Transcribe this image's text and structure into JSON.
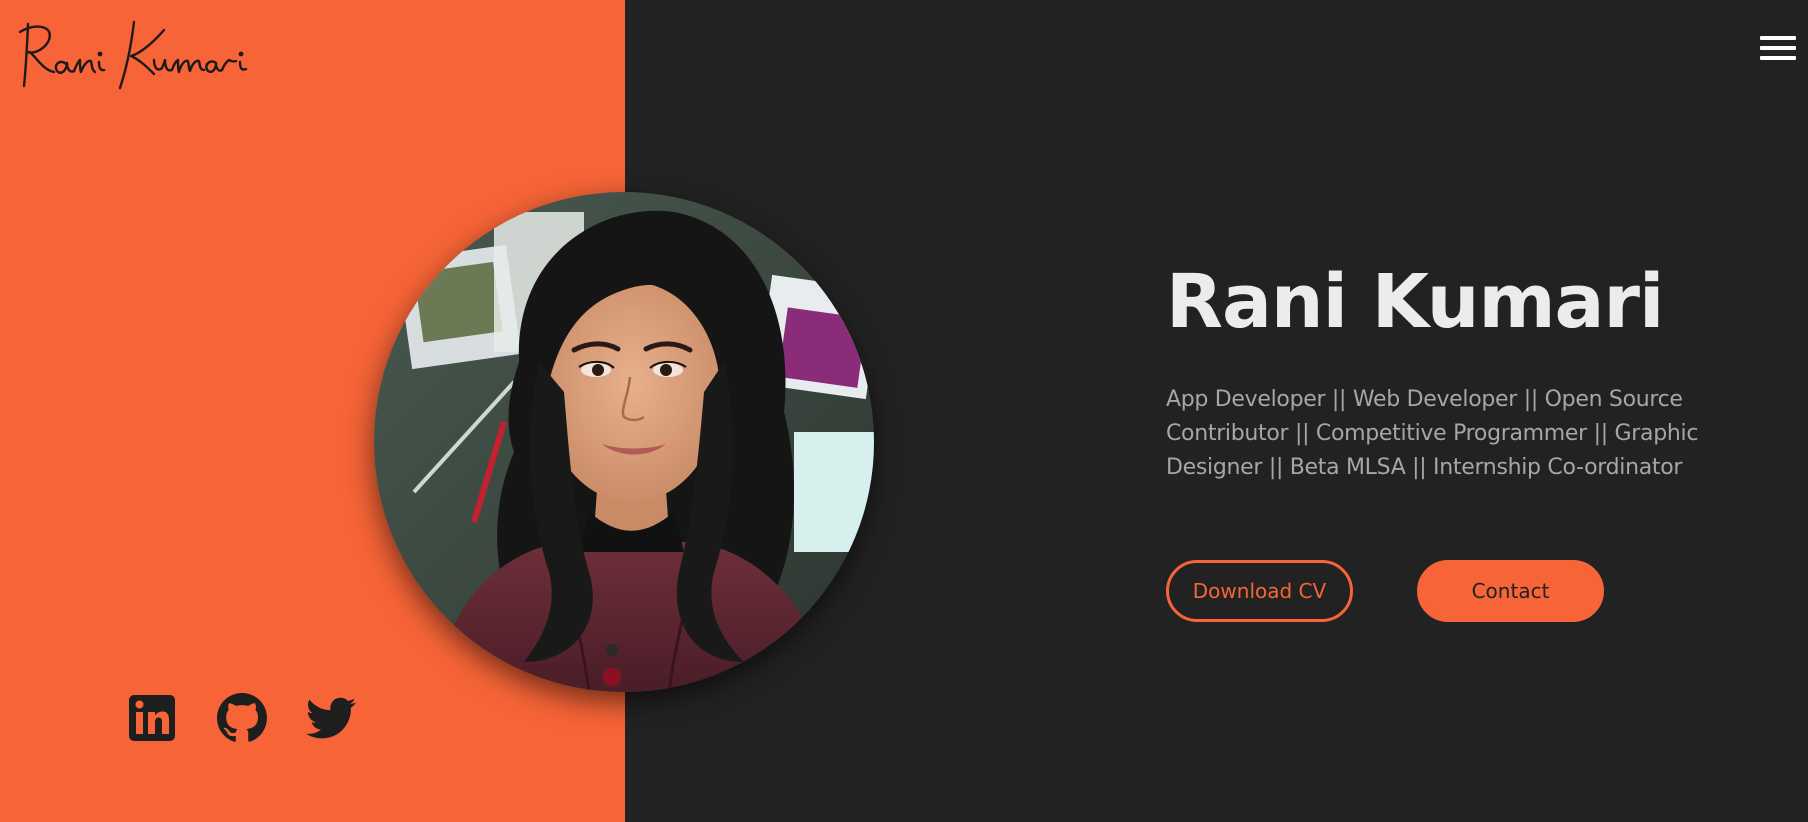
{
  "brand": {
    "logo_text": "Rani Kumari",
    "accent_color": "#f66437",
    "background_dark": "#222222"
  },
  "nav": {
    "menu_icon": "hamburger-menu-icon"
  },
  "hero": {
    "name": "Rani Kumari",
    "tagline": "App Developer || Web Developer || Open Source Contributor || Competitive Programmer || Graphic Designer || Beta MLSA || Internship Co-ordinator",
    "download_cv_label": "Download CV",
    "contact_label": "Contact"
  },
  "profile_photo": {
    "alt": "Rani Kumari"
  },
  "social_links": [
    {
      "name": "LinkedIn",
      "icon": "linkedin-icon"
    },
    {
      "name": "GitHub",
      "icon": "github-icon"
    },
    {
      "name": "Twitter",
      "icon": "twitter-icon"
    }
  ]
}
